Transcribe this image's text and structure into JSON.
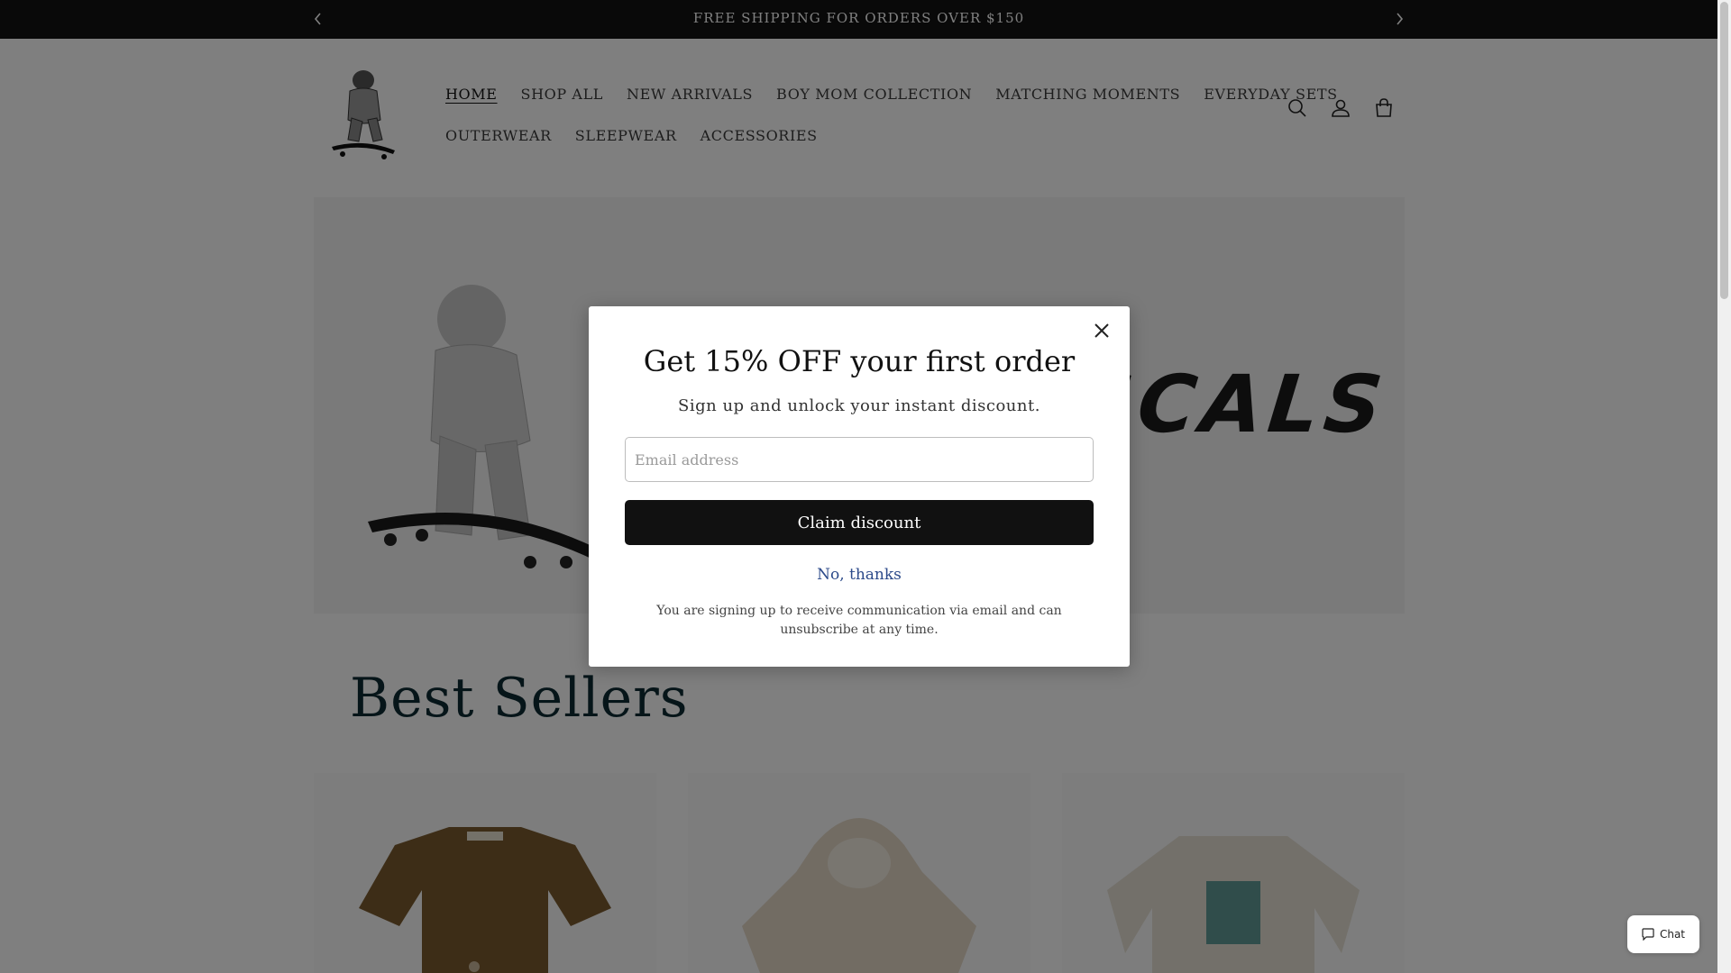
{
  "announcement": {
    "text": "FREE SHIPPING FOR ORDERS OVER $150"
  },
  "nav": {
    "row1": [
      "HOME",
      "SHOP ALL",
      "NEW ARRIVALS",
      "BOY MOM COLLECTION",
      "MATCHING MOMENTS",
      "EVERYDAY SETS"
    ],
    "row2": [
      "OUTERWEAR",
      "SLEEPWEAR",
      "ACCESSORIES"
    ],
    "active": "HOME"
  },
  "header_icons": [
    "search-icon",
    "account-icon",
    "cart-icon"
  ],
  "hero": {
    "brand_partial": "SCALS"
  },
  "best_sellers": {
    "title": "Best Sellers"
  },
  "popup": {
    "title": "Get 15% OFF your first order",
    "subtitle": "Sign up and unlock your instant discount.",
    "email_placeholder": "Email address",
    "claim_label": "Claim discount",
    "decline_label": "No, thanks",
    "legal": "You are signing up to receive communication via email and can unsubscribe at any time."
  },
  "chat": {
    "label": "Chat"
  },
  "colors": {
    "announcement_bg": "#121212",
    "heading": "#0d2a33",
    "link": "#2c4a8a"
  }
}
